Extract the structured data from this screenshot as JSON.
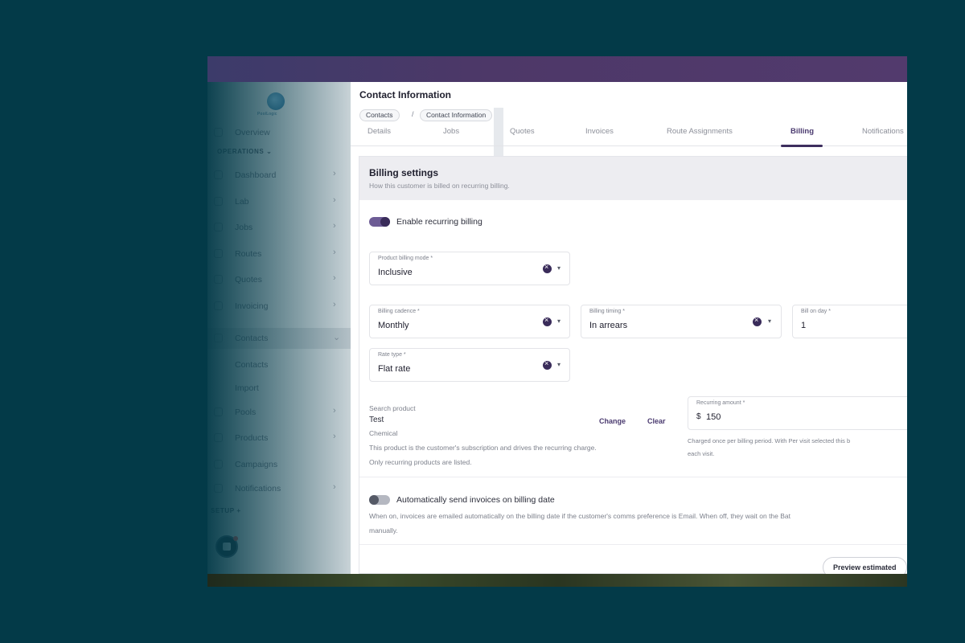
{
  "sidebar": {
    "logo_text": "PoolLogic",
    "overview": "Overview",
    "section_operations": "OPERATIONS",
    "items": [
      {
        "label": "Dashboard",
        "chevron": "›"
      },
      {
        "label": "Lab",
        "chevron": "›"
      },
      {
        "label": "Jobs",
        "chevron": "›"
      },
      {
        "label": "Routes",
        "chevron": "›"
      },
      {
        "label": "Quotes",
        "chevron": "›"
      },
      {
        "label": "Invoicing",
        "chevron": "›"
      },
      {
        "label": "Contacts",
        "chevron": "⌄"
      }
    ],
    "subitems": [
      "Contacts",
      "Import"
    ],
    "items2": [
      {
        "label": "Pools",
        "chevron": "›"
      },
      {
        "label": "Products",
        "chevron": "›"
      },
      {
        "label": "Campaigns",
        "chevron": ""
      },
      {
        "label": "Notifications",
        "chevron": "›"
      }
    ],
    "section_setup": "SETUP",
    "setup_add": "+"
  },
  "header": {
    "title": "Contact Information",
    "breadcrumbs": [
      "Contacts",
      "Contact Information"
    ],
    "breadcrumb_sep": "/"
  },
  "tabs": [
    "Details",
    "Jobs",
    "Quotes",
    "Invoices",
    "Route Assignments",
    "Billing",
    "Notifications"
  ],
  "billing": {
    "title": "Billing settings",
    "subtitle": "How this customer is billed on recurring billing.",
    "recurring_toggle_label": "Enable recurring billing",
    "product_billing_mode": {
      "label": "Product billing mode *",
      "value": "Inclusive"
    },
    "billing_cadence": {
      "label": "Billing cadence *",
      "value": "Monthly"
    },
    "billing_timing": {
      "label": "Billing timing *",
      "value": "In arrears"
    },
    "bill_on_day": {
      "label": "Bill on day *",
      "value": "1"
    },
    "rate_type": {
      "label": "Rate type *",
      "value": "Flat rate"
    },
    "search_product_label": "Search product",
    "product_name": "Test",
    "product_category": "Chemical",
    "change_label": "Change",
    "clear_label": "Clear",
    "product_help_1": "This product is the customer's subscription and drives the recurring charge.",
    "product_help_2": "Only recurring products are listed.",
    "recurring_amount": {
      "label": "Recurring amount *",
      "currency": "$",
      "value": "150"
    },
    "amount_help_1": "Charged once per billing period. With Per visit selected this b",
    "amount_help_2": "each visit.",
    "auto_send_label": "Automatically send invoices on billing date",
    "auto_send_help_1": "When on, invoices are emailed automatically on the billing date if the customer's comms preference is Email. When off, they wait on the Bat",
    "auto_send_help_2": "manually.",
    "preview_button": "Preview estimated"
  },
  "colors": {
    "accent": "#3a2c5a",
    "topbar": "#4d3868",
    "background": "#033a48"
  }
}
